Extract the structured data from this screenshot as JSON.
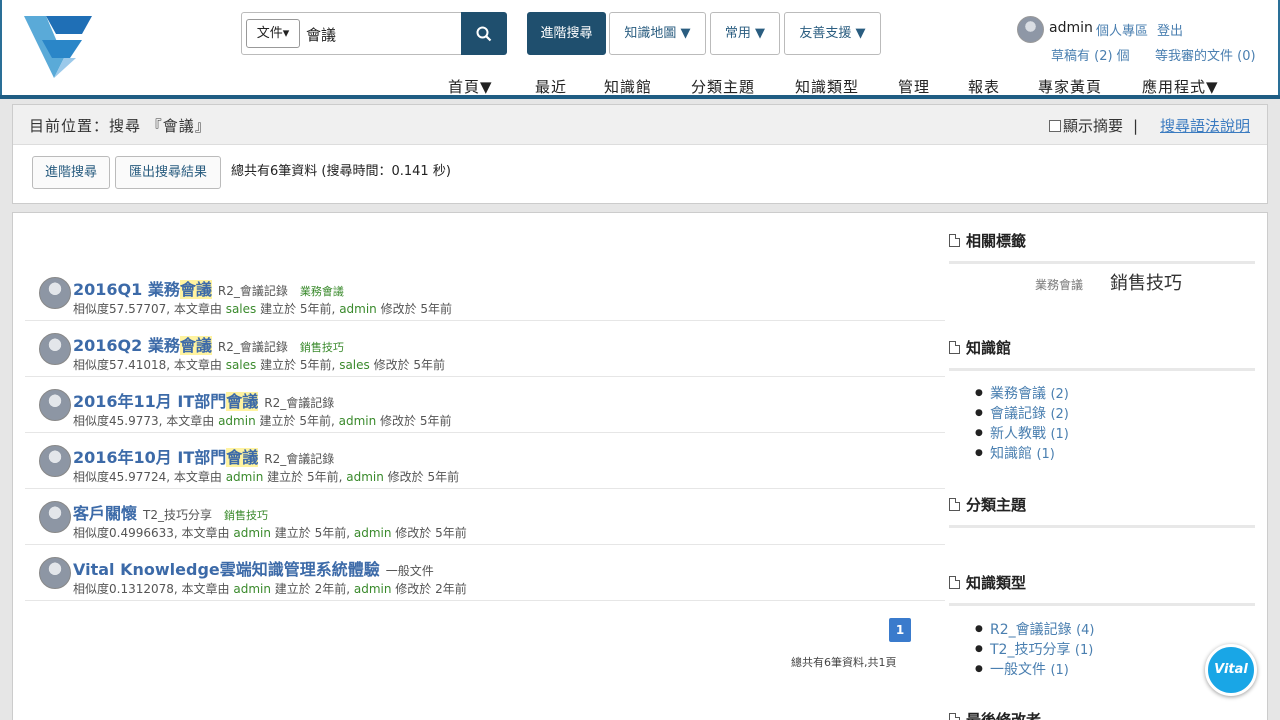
{
  "header": {
    "search": {
      "type_label": "文件▾",
      "value": "會議"
    },
    "buttons": {
      "advanced": "進階搜尋",
      "knowledge_map": "知識地圖 ▼",
      "common": "常用 ▼",
      "support": "友善支援 ▼"
    },
    "user": {
      "name": "admin",
      "profile": "個人專區",
      "logout": "登出",
      "drafts": "草稿有 (2) 個",
      "pending": "等我審的文件 (0)"
    },
    "nav": [
      "首頁▼",
      "最近",
      "知識館",
      "分類主題",
      "知識類型",
      "管理",
      "報表",
      "專家黃頁",
      "應用程式▼"
    ]
  },
  "crumb": {
    "location": "目前位置：搜尋 『會議』",
    "show_summary": "顯示摘要",
    "separator": "|",
    "syntax_help": "搜尋語法說明",
    "advanced_btn": "進階搜尋",
    "export_btn": "匯出搜尋結果",
    "total": "總共有6筆資料 (搜尋時間：0.141 秒)"
  },
  "results": [
    {
      "pre": "2016Q1 業務",
      "hl": "會議",
      "post": "",
      "cat": "R2_會議記錄",
      "tag": "業務會議",
      "sim": "相似度57.57707, 本文章由 ",
      "creator": "sales",
      "mid": " 建立於 5年前, ",
      "editor": "admin",
      "end": " 修改於 5年前"
    },
    {
      "pre": "2016Q2 業務",
      "hl": "會議",
      "post": "",
      "cat": "R2_會議記錄",
      "tag": "銷售技巧",
      "sim": "相似度57.41018, 本文章由 ",
      "creator": "sales",
      "mid": " 建立於 5年前, ",
      "editor": "sales",
      "end": " 修改於 5年前"
    },
    {
      "pre": "2016年11月 IT部門",
      "hl": "會議",
      "post": "",
      "cat": "R2_會議記錄",
      "tag": "",
      "sim": "相似度45.9773, 本文章由 ",
      "creator": "admin",
      "mid": " 建立於 5年前, ",
      "editor": "admin",
      "end": " 修改於 5年前"
    },
    {
      "pre": "2016年10月 IT部門",
      "hl": "會議",
      "post": "",
      "cat": "R2_會議記錄",
      "tag": "",
      "sim": "相似度45.97724, 本文章由 ",
      "creator": "admin",
      "mid": " 建立於 5年前, ",
      "editor": "admin",
      "end": " 修改於 5年前"
    },
    {
      "pre": "客戶關懷",
      "hl": "",
      "post": "",
      "cat": "T2_技巧分享",
      "tag": "銷售技巧",
      "sim": "相似度0.4996633, 本文章由 ",
      "creator": "admin",
      "mid": " 建立於 5年前, ",
      "editor": "admin",
      "end": " 修改於 5年前"
    },
    {
      "pre": "Vital Knowledge雲端知識管理系統體驗",
      "hl": "",
      "post": "",
      "cat": "一般文件",
      "tag": "",
      "sim": "相似度0.1312078, 本文章由 ",
      "creator": "admin",
      "mid": " 建立於 2年前, ",
      "editor": "admin",
      "end": " 修改於 2年前"
    }
  ],
  "pagination": {
    "current": "1",
    "info": "總共有6筆資料,共1頁"
  },
  "sidebar": {
    "tags_title": "相關標籤",
    "tags": [
      "業務會議",
      "銷售技巧"
    ],
    "library_title": "知識館",
    "library": [
      {
        "label": "業務會議",
        "count": "(2)"
      },
      {
        "label": "會議記錄",
        "count": "(2)"
      },
      {
        "label": "新人教戰",
        "count": "(1)"
      },
      {
        "label": "知識館",
        "count": "(1)"
      }
    ],
    "topics_title": "分類主題",
    "types_title": "知識類型",
    "types": [
      {
        "label": "R2_會議記錄",
        "count": "(4)"
      },
      {
        "label": "T2_技巧分享",
        "count": "(1)"
      },
      {
        "label": "一般文件",
        "count": "(1)"
      }
    ],
    "last_title": "最後修改者"
  },
  "vital_label": "Vital",
  "colors": {
    "primary": "#1f4f6e",
    "link": "#4a7fb0",
    "highlight": "#fff3a0",
    "user": "#3a8a2c"
  }
}
